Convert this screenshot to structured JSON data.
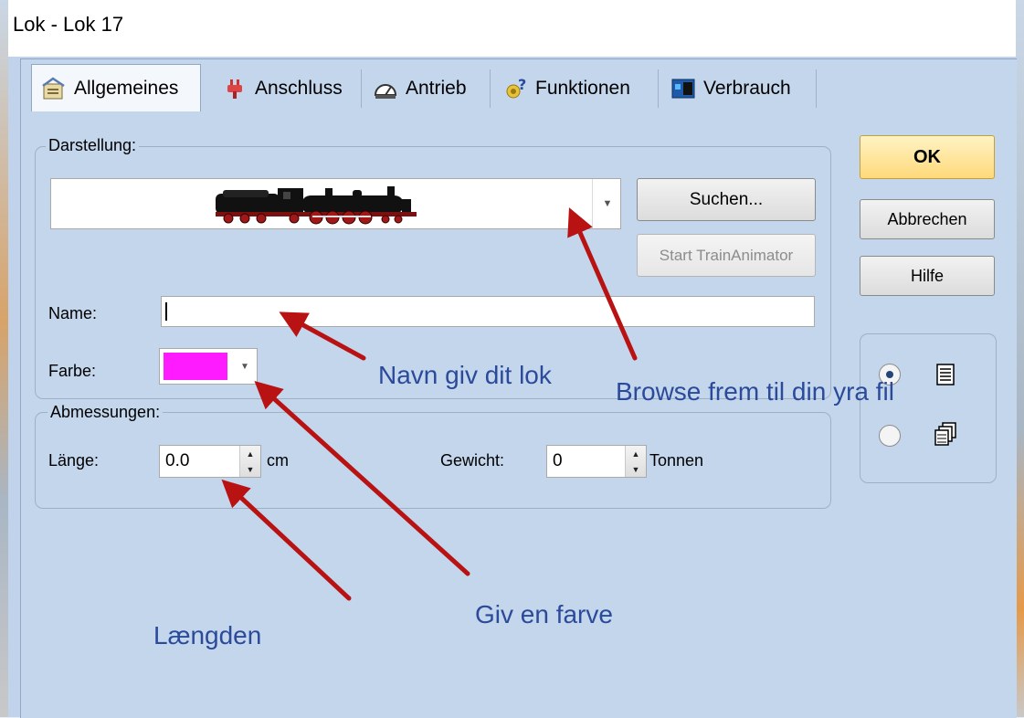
{
  "window": {
    "title": "Lok - Lok 17"
  },
  "tabs": [
    {
      "label": "Allgemeines",
      "icon": "properties-icon",
      "active": true
    },
    {
      "label": "Anschluss",
      "icon": "plug-icon"
    },
    {
      "label": "Antrieb",
      "icon": "gauge-icon"
    },
    {
      "label": "Funktionen",
      "icon": "functions-icon"
    },
    {
      "label": "Verbrauch",
      "icon": "consumption-icon"
    }
  ],
  "darstellung": {
    "group_label": "Darstellung:",
    "image_icon": "steam-locomotive-icon",
    "search_button": "Suchen...",
    "animator_button": "Start TrainAnimator"
  },
  "name": {
    "label": "Name:",
    "value": ""
  },
  "farbe": {
    "label": "Farbe:",
    "color": "#ff1bff"
  },
  "abmessungen": {
    "group_label": "Abmessungen:",
    "laenge_label": "Länge:",
    "laenge_value": "0.0",
    "laenge_unit": "cm",
    "gewicht_label": "Gewicht:",
    "gewicht_value": "0",
    "gewicht_unit": "Tonnen"
  },
  "buttons": {
    "ok": "OK",
    "cancel": "Abbrechen",
    "help": "Hilfe"
  },
  "view_options": {
    "selected": "list",
    "options": [
      "list-view-icon",
      "multi-view-icon"
    ]
  },
  "annotations": {
    "name": "Navn giv dit lok",
    "browse": "Browse frem til din yra fil",
    "color": "Giv en farve",
    "length": "Længden",
    "arrow_color": "#b81212"
  }
}
